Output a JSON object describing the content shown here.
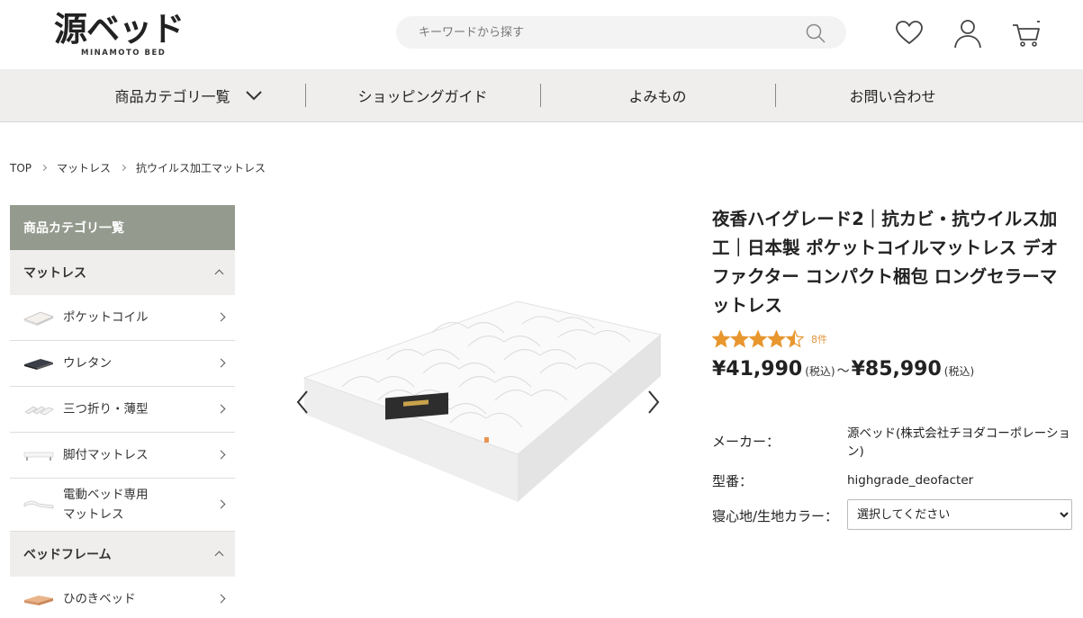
{
  "header": {
    "logo_text": "源ベッド",
    "logo_sub": "MINAMOTO BED",
    "search_placeholder": "キーワードから探す",
    "icons": [
      "search-icon",
      "heart-icon",
      "user-icon",
      "cart-icon"
    ]
  },
  "nav": {
    "items": [
      {
        "label": "商品カテゴリ一覧"
      },
      {
        "label": "ショッピングガイド"
      },
      {
        "label": "よみもの"
      },
      {
        "label": "お問い合わせ"
      }
    ]
  },
  "breadcrumb": [
    "TOP",
    "マットレス",
    "抗ウイルス加工マットレス"
  ],
  "sidebar": {
    "title": "商品カテゴリ一覧",
    "categories": [
      {
        "label": "マットレス",
        "items": [
          {
            "label": "ポケットコイル"
          },
          {
            "label": "ウレタン"
          },
          {
            "label": "三つ折り・薄型"
          },
          {
            "label": "脚付マットレス"
          },
          {
            "label": "電動ベッド専用\nマットレス"
          }
        ]
      },
      {
        "label": "ベッドフレーム",
        "items": [
          {
            "label": "ひのきベッド"
          }
        ]
      }
    ]
  },
  "product": {
    "title": "夜香ハイグレード2｜抗カビ・抗ウイルス加工｜日本製 ポケットコイルマットレス デオファクター コンパクト梱包 ロングセラーマットレス",
    "rating": 4.5,
    "rating_max": 5,
    "review_count": "8件",
    "price_min": "¥41,990",
    "price_max": "¥85,990",
    "tax_label": "(税込)",
    "range_sep": "～",
    "maker_label": "メーカー：",
    "maker_value": "源ベッド(株式会社チヨダコーポレーション)",
    "model_label": "型番：",
    "model_value": "highgrade_deofacter",
    "color_label": "寝心地/生地カラー：",
    "color_selected": "選択してください"
  },
  "colors": {
    "nav_bg": "#efeeec",
    "sidebar_title_bg": "#949a8e",
    "star": "#e8962e"
  }
}
